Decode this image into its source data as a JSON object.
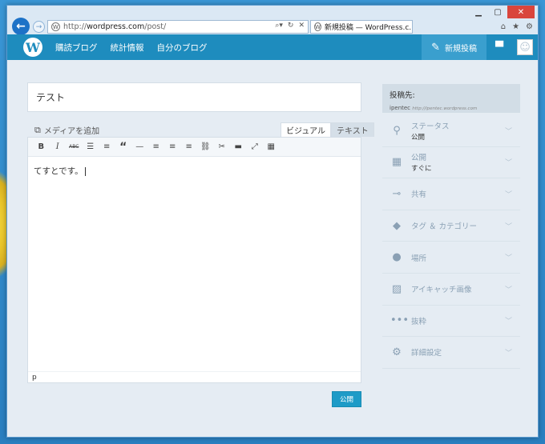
{
  "browser": {
    "address_scheme": "http://",
    "address_host": "wordpress.com",
    "address_path": "/post/",
    "tab_title": "新規投稿 — WordPress.c...",
    "tab_close": "×"
  },
  "masterbar": {
    "logo": "W",
    "links": [
      "購読ブログ",
      "統計情報",
      "自分のブログ"
    ],
    "new_post": "新規投稿"
  },
  "editor": {
    "title_value": "テスト",
    "add_media": "メディアを追加",
    "tabs": [
      "ビジュアル",
      "テキスト"
    ],
    "toolbar_text": {
      "bold": "B",
      "italic": "I",
      "strike": "ABC",
      "quote": "“"
    },
    "content": "てすとです。",
    "path": "p"
  },
  "publish_button": "公開",
  "sidebar": {
    "post_to_label": "投稿先:",
    "site_name": "ipentec",
    "site_url": "http://ipentec.wordpress.com",
    "items": [
      {
        "label": "ステータス",
        "sub": "公開",
        "icon": "pin-icon"
      },
      {
        "label": "公開",
        "sub": "すぐに",
        "icon": "calendar-icon"
      },
      {
        "label": "共有",
        "sub": "",
        "icon": "share-icon"
      },
      {
        "label": "タグ ＆ カテゴリー",
        "sub": "",
        "icon": "tag-icon"
      },
      {
        "label": "場所",
        "sub": "",
        "icon": "location-icon"
      },
      {
        "label": "アイキャッチ画像",
        "sub": "",
        "icon": "image-icon"
      },
      {
        "label": "抜粋",
        "sub": "",
        "icon": "ellipsis-icon"
      },
      {
        "label": "詳細設定",
        "sub": "",
        "icon": "gear-icon"
      }
    ]
  }
}
